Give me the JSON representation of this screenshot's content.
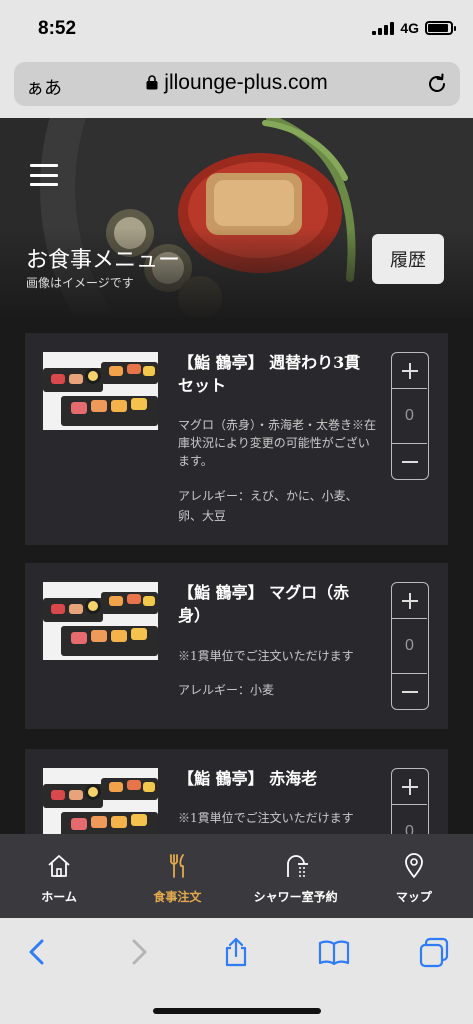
{
  "status_bar": {
    "time": "8:52",
    "network": "4G",
    "battery_level": 0.9
  },
  "browser": {
    "text_size_label": "ぁあ",
    "url": "jllounge-plus.com"
  },
  "hero": {
    "title": "お食事メニュー",
    "subtitle": "画像はイメージです",
    "history_label": "履歴"
  },
  "menu_items": [
    {
      "name": "【鮨 鶴亭】 週替わり3貫セット",
      "description": "マグロ（赤身）・赤海老・太巻き※在庫状況により変更の可能性がございます。",
      "allergy": "アレルギー：えび、かに、小麦、卵、大豆",
      "quantity": "0"
    },
    {
      "name": "【鮨 鶴亭】 マグロ（赤身）",
      "description": "※1貫単位でご注文いただけます",
      "allergy": "アレルギー：小麦",
      "quantity": "0"
    },
    {
      "name": "【鮨 鶴亭】 赤海老",
      "description": "※1貫単位でご注文いただけます",
      "allergy": "",
      "quantity": "0"
    }
  ],
  "bottom_nav": [
    {
      "label": "ホーム",
      "icon": "home-icon",
      "active": false
    },
    {
      "label": "食事注文",
      "icon": "fork-knife-icon",
      "active": true
    },
    {
      "label": "シャワー室予約",
      "icon": "shower-icon",
      "active": false
    },
    {
      "label": "マップ",
      "icon": "map-pin-icon",
      "active": false
    }
  ],
  "colors": {
    "accent": "#e3a94d",
    "card_bg": "#29292d",
    "nav_bg": "#3a3a3e",
    "ios_blue": "#2f7cf6"
  }
}
